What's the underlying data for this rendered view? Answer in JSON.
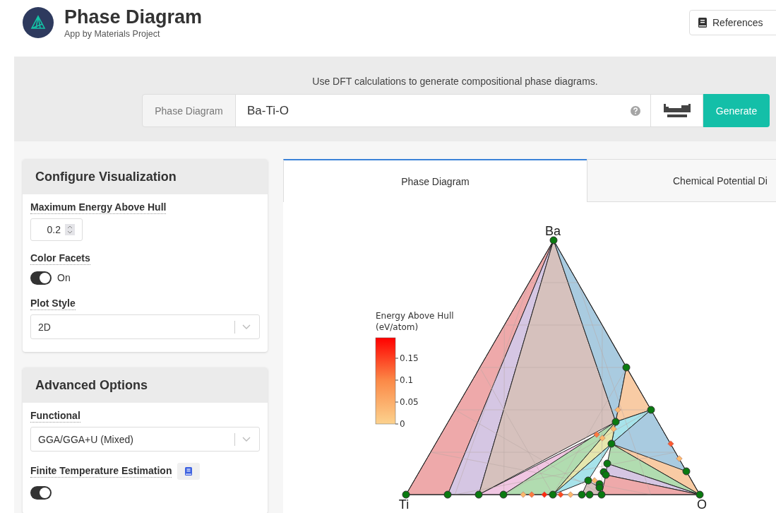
{
  "header": {
    "title": "Phase Diagram",
    "subtitle": "App by Materials Project",
    "references_button": "References"
  },
  "search": {
    "caption": "Use DFT calculations to generate compositional phase diagrams.",
    "addon": "Phase Diagram",
    "value": "Ba-Ti-O",
    "generate_button": "Generate"
  },
  "panels": [
    {
      "title": "Configure Visualization",
      "fields": [
        {
          "kind": "number",
          "label": "Maximum Energy Above Hull",
          "value": "0.2"
        },
        {
          "kind": "toggle",
          "label": "Color Facets",
          "on": true,
          "text": "On"
        },
        {
          "kind": "select",
          "label": "Plot Style",
          "value": "2D"
        }
      ]
    },
    {
      "title": "Advanced Options",
      "fields": [
        {
          "kind": "select",
          "label": "Functional",
          "value": "GGA/GGA+U (Mixed)"
        },
        {
          "kind": "toggle",
          "label": "Finite Temperature Estimation",
          "on": true,
          "info_icon": true
        }
      ]
    }
  ],
  "tabs": [
    {
      "label": "Phase Diagram",
      "selected": true
    },
    {
      "label": "Chemical Potential Di",
      "selected": false
    }
  ],
  "plot": {
    "corner_labels": [
      "Ba",
      "Ti",
      "O"
    ],
    "colorbar_title": [
      "Energy Above Hull",
      "(eV/atom)"
    ],
    "colorbar_ticks": [
      "0.15",
      "0.1",
      "0.05",
      "0"
    ]
  }
}
